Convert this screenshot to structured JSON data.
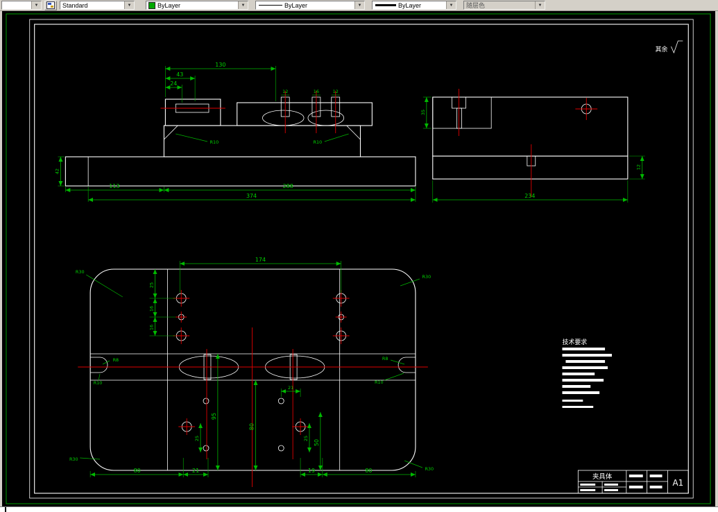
{
  "toolbar": {
    "layer_combo": {
      "value": ""
    },
    "style_combo": {
      "value": "Standard"
    },
    "color_combo": {
      "value": "ByLayer"
    },
    "linetype_combo": {
      "value": "ByLayer"
    },
    "lineweight_combo": {
      "value": "ByLayer"
    },
    "plot_style_combo": {
      "value": "随层色"
    }
  },
  "colors": {
    "dimension_green": "#00b800",
    "centerline_red": "#e00000",
    "geometry_white": "#ffffff",
    "limits_border_green": "#00a000"
  },
  "sheet": {
    "surface_note": "其余",
    "tech_requirements_title": "技术要求",
    "title_block": {
      "part_name": "夹具体",
      "sheet_size": "A1"
    }
  },
  "front_view": {
    "dims": {
      "top_width": "130",
      "step1": "43",
      "step2": "24",
      "left_height": "42",
      "slot1": "12",
      "slot2": "16",
      "slot3": "12",
      "bottom_left": "113",
      "bottom_mid": "288",
      "total_width": "374",
      "fillet_left": "R10",
      "fillet_right": "R10"
    }
  },
  "side_view": {
    "dims": {
      "total_width": "234",
      "left_height": "35",
      "step_height": "12"
    }
  },
  "plan_view": {
    "dims": {
      "hole_span": "174",
      "row1": "25",
      "row2": "16",
      "row3": "16",
      "bottom1": "80",
      "bottom2": "21",
      "bottom3": "19",
      "bottom4": "80",
      "v95": "95",
      "v80": "80",
      "v50": "50",
      "v25l": "25",
      "v25r": "25",
      "slot_span": "21",
      "corner_tl": "R30",
      "corner_tr": "R30",
      "corner_bl": "R30",
      "corner_br": "R30",
      "notch_r8_left": "R8",
      "notch_r8_right": "R8",
      "notch_r10_left": "R10",
      "notch_r10_right": "R10"
    }
  }
}
